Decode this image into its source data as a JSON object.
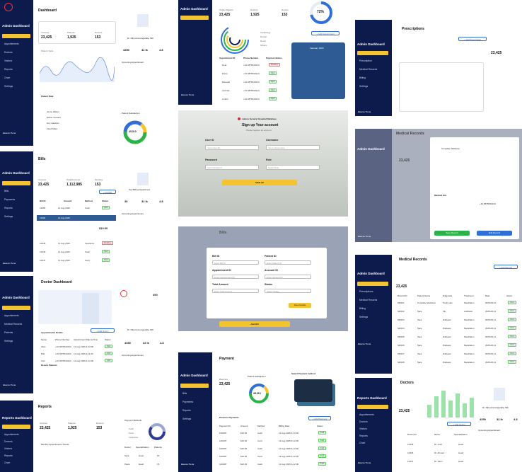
{
  "colors": {
    "sidebar": "#0d1b4c",
    "accent": "#f4c430",
    "blue": "#2f6fd6",
    "green": "#2bb34a"
  },
  "dashboard": {
    "sidebar_title": "Admin Dashboard",
    "menu": [
      "Appointments",
      "Doctors",
      "Visitors",
      "Reports",
      "Chart",
      "Settings"
    ],
    "page_title": "Dashboard",
    "stats": [
      {
        "label": "Invoices",
        "value": "23,425"
      },
      {
        "label": "Patients",
        "value": "1,925"
      },
      {
        "label": "Doctors",
        "value": "153"
      }
    ],
    "visitor_label": "Patient Visits",
    "doctor_name": "Dr. Dilip Ammangandla, MD",
    "doctor_stats": [
      "4350",
      "32 lk",
      "4.8"
    ],
    "upcoming": "Upcoming Appointment",
    "patient_data": "Patient Data",
    "patient_rows": [
      "Jenny Wilson",
      "Esther Howard",
      "Guy Hawkins",
      "Floyd Miles"
    ],
    "satisfaction": "Patient Satisfaction",
    "satisfaction_value": "45,310",
    "user": "Eleanor Pena"
  },
  "dashboard2": {
    "sidebar_title": "Admin Dashboard",
    "stats": [
      {
        "label": "Today Patients",
        "value": "23,425"
      },
      {
        "label": "Doctors",
        "value": "1,925"
      },
      {
        "label": "Nurses",
        "value": "153"
      }
    ],
    "percent": "72%",
    "add_btn": "+ Add Appointment",
    "legend": [
      "Cardiology",
      "Dental",
      "Neuro",
      "Others"
    ],
    "cols": [
      "Appointment ID",
      "Phone Number",
      "Payment Status"
    ],
    "rows": [
      [
        "Dear",
        "+91 9876543210",
        "Pending"
      ],
      [
        "Paulo",
        "+91 9876543210",
        "Paid"
      ],
      [
        "Bravado",
        "+91 9876543210",
        "Paid"
      ],
      [
        "Cascais",
        "+91 9876543210",
        "Paid"
      ],
      [
        "Lisbon",
        "+91 9876543210",
        "Paid"
      ]
    ],
    "calendar_title": "February 2025",
    "user": "Eleanor Pena"
  },
  "prescriptions": {
    "title": "Prescriptions",
    "stat": "23,425",
    "add_btn": "+ Add Prescription",
    "menu": [
      "Prescription",
      "Medical Records",
      "Billing",
      "Settings"
    ],
    "sidebar_title": "Admin Dashboard",
    "user": "Eleanor Pena"
  },
  "signup": {
    "hospital": "Lahore General Hospital Database",
    "heading": "Sign up Your account",
    "sub": "Please register an account",
    "fields": [
      {
        "label": "User ID",
        "placeholder": "Input User ID"
      },
      {
        "label": "Username",
        "placeholder": "Input A Username"
      },
      {
        "label": "Password",
        "placeholder": "Input Password"
      },
      {
        "label": "Role",
        "placeholder": "Select Role"
      }
    ],
    "button": "SIGN UP"
  },
  "bills": {
    "title": "Bills",
    "sidebar_title": "Admin Dashboard",
    "menu": [
      "Bills",
      "Payments",
      "Reports",
      "Settings"
    ],
    "stats": [
      {
        "label": "Invoices",
        "value": "23,425"
      },
      {
        "label": "Total Revenue",
        "value": "1,112,985"
      },
      {
        "label": "Pending",
        "value": "153"
      }
    ],
    "add_btn": "+ Add Bill",
    "cols": [
      "Bill ID",
      "Amount",
      "Method",
      "Status"
    ],
    "rows": [
      [
        "19455",
        "12 Aug 2025",
        "Cash",
        "Paid"
      ],
      [
        "12394",
        "12 Aug 2025",
        "Card",
        "Paid"
      ],
      [
        "12345",
        "12 Aug 2025",
        "Insurance",
        "Pending"
      ],
      [
        "12346",
        "12 Aug 2025",
        "Cash",
        "Paid"
      ],
      [
        "12347",
        "12 Aug 2025",
        "Card",
        "Paid"
      ]
    ],
    "top_dept": "Top Billing Department",
    "doctor_stats": [
      "30",
      "32 lk",
      "4.8"
    ],
    "upcoming": "Upcoming Appointment",
    "amount": "$10.00",
    "user": "Eleanor Pena"
  },
  "billform": {
    "fields": [
      {
        "label": "Bill ID",
        "placeholder": "Enter Bill ID"
      },
      {
        "label": "Patient ID",
        "placeholder": "Enter Patient ID"
      },
      {
        "label": "Appointment ID",
        "placeholder": "Enter Appointment ID"
      },
      {
        "label": "Account ID",
        "placeholder": "Enter Account ID"
      },
      {
        "label": "Total Amount",
        "placeholder": "Enter Total Amount"
      },
      {
        "label": "Status",
        "placeholder": "Select Status"
      }
    ],
    "save_btn": "Save Details",
    "add_btn": "Add Bill",
    "title": "Bills"
  },
  "medical1": {
    "title": "Medical Records",
    "sidebar_title": "Admin Dashboard",
    "stat": "23,425",
    "record_title": "Medical Info",
    "patient_name": "Complete Wellness",
    "phone": "+91 9876543210",
    "save_btn": "Save Record",
    "cancel_btn": "Edit Record",
    "user": "Eleanor Pena"
  },
  "medical2": {
    "title": "Medical Records",
    "sidebar_title": "Admin Dashboard",
    "menu": [
      "Prescriptions",
      "Medical Records",
      "Billing",
      "Settings"
    ],
    "stat": "23,425",
    "add_btn": "+ Add Record",
    "cols": [
      "Record ID",
      "Patient Name",
      "Diagnosis",
      "Treatment",
      "Date",
      "Action"
    ],
    "rows": [
      [
        "MR101",
        "Complete Wellness",
        "Tooth pain",
        "Medication",
        "2025-06-10"
      ],
      [
        "MR102",
        "Sara",
        "Flu",
        "Antibiotic",
        "2025-06-11"
      ],
      [
        "MR103",
        "Sara",
        "Diabetes",
        "Medication",
        "2025-06-11"
      ],
      [
        "MR104",
        "Sara",
        "Diabetes",
        "Medication",
        "2025-06-11"
      ],
      [
        "MR105",
        "Sara",
        "Diabetes",
        "Medication",
        "2025-06-11"
      ],
      [
        "MR106",
        "Sara",
        "Diabetes",
        "Medication",
        "2025-06-11"
      ],
      [
        "MR107",
        "Sara",
        "Diabetes",
        "Medication",
        "2025-06-11"
      ],
      [
        "MR108",
        "Sara",
        "Diabetes",
        "Medication",
        "2025-06-11"
      ]
    ],
    "action": "View",
    "user": "Eleanor Pena"
  },
  "doctor": {
    "title": "Doctor Dashboard",
    "sidebar_title": "Admin Dashboard",
    "menu": [
      "Appointments",
      "Medical Records",
      "Patients",
      "Settings"
    ],
    "stat": "490",
    "appt_title": "Appointments Details",
    "add_btn": "+ Add Doctor",
    "cols": [
      "Name",
      "Phone Number",
      "Appointment Date & Time",
      "Status"
    ],
    "rows": [
      [
        "Alice",
        "+91 9876543210",
        "12 Aug 2025 & 10:00",
        "Paid"
      ],
      [
        "Bob",
        "+91 9876543210",
        "12 Aug 2025 & 11:00",
        "Paid"
      ],
      [
        "Carl",
        "+91 9876543210",
        "12 Aug 2025 & 12:00",
        "Paid"
      ]
    ],
    "recent": "Recent Patients",
    "doctor_name": "Dr. Dilip Ammangandla, MD",
    "doctor_stats": [
      "4350",
      "32 lk",
      "4.8"
    ],
    "upcoming": "Upcoming Appointment",
    "user": "Eleanor Pena"
  },
  "payment": {
    "title": "Payment",
    "sidebar_title": "Admin Dashboard",
    "menu": [
      "Bills",
      "Payments",
      "Reports",
      "Settings"
    ],
    "stats": [
      {
        "label": "Revenue",
        "value": "23,425"
      }
    ],
    "satisfaction": "Patient Satisfaction",
    "satisfaction_value": "45,310",
    "method_title": "Select Payment method",
    "prev_title": "Previous Payments",
    "add_btn": "+ Add Payment",
    "cols": [
      "Payment ID",
      "Amount",
      "Method",
      "Billing Date",
      "Status"
    ],
    "rows": [
      [
        "1000RT",
        "$10.00",
        "Cash",
        "12 Aug 2025 & 12:00",
        "Paid"
      ],
      [
        "1001RT",
        "$10.00",
        "Card",
        "12 Aug 2025 & 12:00",
        "Paid"
      ],
      [
        "1002RT",
        "$10.00",
        "Cash",
        "12 Aug 2025 & 12:00",
        "Paid"
      ],
      [
        "1003RT",
        "$10.00",
        "Card",
        "12 Aug 2025 & 12:00",
        "Paid"
      ],
      [
        "1004RT",
        "$10.00",
        "Cash",
        "12 Aug 2025 & 12:00",
        "Paid"
      ]
    ],
    "user": "Eleanor Pena"
  },
  "reports": {
    "title": "Reports",
    "sidebar_title": "Reports Dashboard",
    "menu": [
      "Appointments",
      "Doctors",
      "Visitors",
      "Reports",
      "Chart"
    ],
    "stats": [
      {
        "label": "Invoices",
        "value": "23,425"
      },
      {
        "label": "Patients",
        "value": "1,925"
      },
      {
        "label": "Doctors",
        "value": "153"
      }
    ],
    "trend_title": "Monthly Appointments Trends",
    "method_title": "Payment Methods",
    "legend": [
      "Cash",
      "Card",
      "Insurance"
    ],
    "cols": [
      "Doctor",
      "Specialization",
      "Patients"
    ],
    "rows": [
      [
        "Sara",
        "Heart",
        "15"
      ],
      [
        "Paulo",
        "Heart",
        "15"
      ]
    ]
  },
  "doctors": {
    "title": "Doctors",
    "sidebar_title": "Reports Dashboard",
    "menu": [
      "Appointments",
      "Doctors",
      "Visitors",
      "Reports",
      "Chart"
    ],
    "stat": "23,425",
    "add_btn": "+ Add Doctor",
    "cols": [
      "Doctor ID",
      "Name",
      "Specialization"
    ],
    "rows": [
      [
        "12345",
        "Dr. John",
        "Heart"
      ],
      [
        "12346",
        "Dr. Ahmed",
        "Heart"
      ],
      [
        "12347",
        "Dr. Sami",
        "Heart"
      ]
    ],
    "doctor_name": "Dr. Dilip Ammangandla, MD",
    "doctor_stats": [
      "4350",
      "32 lk",
      "4.8"
    ],
    "upcoming": "Upcoming Appointment",
    "user": "Eleanor Pena"
  }
}
